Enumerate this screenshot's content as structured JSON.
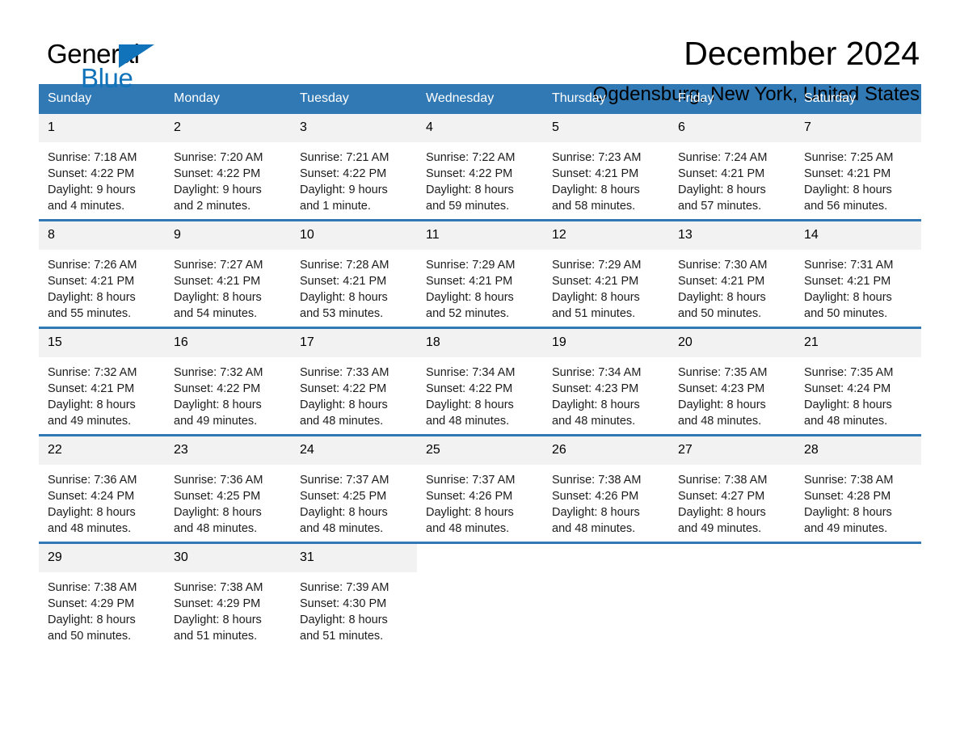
{
  "brand": {
    "name_top": "General",
    "name_bottom": "Blue",
    "triangle_color": "#1173ba",
    "top_color": "#000000",
    "bottom_color": "#1173ba"
  },
  "header": {
    "title": "December 2024",
    "location": "Ogdensburg, New York, United States"
  },
  "theme": {
    "header_bg": "#3179b4",
    "header_text": "#ffffff",
    "daynum_bg": "#f2f2f2",
    "row_divider": "#3179b4",
    "page_bg": "#ffffff"
  },
  "weekdays": [
    "Sunday",
    "Monday",
    "Tuesday",
    "Wednesday",
    "Thursday",
    "Friday",
    "Saturday"
  ],
  "weeks": [
    [
      {
        "day": "1",
        "sunrise": "Sunrise: 7:18 AM",
        "sunset": "Sunset: 4:22 PM",
        "daylight1": "Daylight: 9 hours",
        "daylight2": "and 4 minutes."
      },
      {
        "day": "2",
        "sunrise": "Sunrise: 7:20 AM",
        "sunset": "Sunset: 4:22 PM",
        "daylight1": "Daylight: 9 hours",
        "daylight2": "and 2 minutes."
      },
      {
        "day": "3",
        "sunrise": "Sunrise: 7:21 AM",
        "sunset": "Sunset: 4:22 PM",
        "daylight1": "Daylight: 9 hours",
        "daylight2": "and 1 minute."
      },
      {
        "day": "4",
        "sunrise": "Sunrise: 7:22 AM",
        "sunset": "Sunset: 4:22 PM",
        "daylight1": "Daylight: 8 hours",
        "daylight2": "and 59 minutes."
      },
      {
        "day": "5",
        "sunrise": "Sunrise: 7:23 AM",
        "sunset": "Sunset: 4:21 PM",
        "daylight1": "Daylight: 8 hours",
        "daylight2": "and 58 minutes."
      },
      {
        "day": "6",
        "sunrise": "Sunrise: 7:24 AM",
        "sunset": "Sunset: 4:21 PM",
        "daylight1": "Daylight: 8 hours",
        "daylight2": "and 57 minutes."
      },
      {
        "day": "7",
        "sunrise": "Sunrise: 7:25 AM",
        "sunset": "Sunset: 4:21 PM",
        "daylight1": "Daylight: 8 hours",
        "daylight2": "and 56 minutes."
      }
    ],
    [
      {
        "day": "8",
        "sunrise": "Sunrise: 7:26 AM",
        "sunset": "Sunset: 4:21 PM",
        "daylight1": "Daylight: 8 hours",
        "daylight2": "and 55 minutes."
      },
      {
        "day": "9",
        "sunrise": "Sunrise: 7:27 AM",
        "sunset": "Sunset: 4:21 PM",
        "daylight1": "Daylight: 8 hours",
        "daylight2": "and 54 minutes."
      },
      {
        "day": "10",
        "sunrise": "Sunrise: 7:28 AM",
        "sunset": "Sunset: 4:21 PM",
        "daylight1": "Daylight: 8 hours",
        "daylight2": "and 53 minutes."
      },
      {
        "day": "11",
        "sunrise": "Sunrise: 7:29 AM",
        "sunset": "Sunset: 4:21 PM",
        "daylight1": "Daylight: 8 hours",
        "daylight2": "and 52 minutes."
      },
      {
        "day": "12",
        "sunrise": "Sunrise: 7:29 AM",
        "sunset": "Sunset: 4:21 PM",
        "daylight1": "Daylight: 8 hours",
        "daylight2": "and 51 minutes."
      },
      {
        "day": "13",
        "sunrise": "Sunrise: 7:30 AM",
        "sunset": "Sunset: 4:21 PM",
        "daylight1": "Daylight: 8 hours",
        "daylight2": "and 50 minutes."
      },
      {
        "day": "14",
        "sunrise": "Sunrise: 7:31 AM",
        "sunset": "Sunset: 4:21 PM",
        "daylight1": "Daylight: 8 hours",
        "daylight2": "and 50 minutes."
      }
    ],
    [
      {
        "day": "15",
        "sunrise": "Sunrise: 7:32 AM",
        "sunset": "Sunset: 4:21 PM",
        "daylight1": "Daylight: 8 hours",
        "daylight2": "and 49 minutes."
      },
      {
        "day": "16",
        "sunrise": "Sunrise: 7:32 AM",
        "sunset": "Sunset: 4:22 PM",
        "daylight1": "Daylight: 8 hours",
        "daylight2": "and 49 minutes."
      },
      {
        "day": "17",
        "sunrise": "Sunrise: 7:33 AM",
        "sunset": "Sunset: 4:22 PM",
        "daylight1": "Daylight: 8 hours",
        "daylight2": "and 48 minutes."
      },
      {
        "day": "18",
        "sunrise": "Sunrise: 7:34 AM",
        "sunset": "Sunset: 4:22 PM",
        "daylight1": "Daylight: 8 hours",
        "daylight2": "and 48 minutes."
      },
      {
        "day": "19",
        "sunrise": "Sunrise: 7:34 AM",
        "sunset": "Sunset: 4:23 PM",
        "daylight1": "Daylight: 8 hours",
        "daylight2": "and 48 minutes."
      },
      {
        "day": "20",
        "sunrise": "Sunrise: 7:35 AM",
        "sunset": "Sunset: 4:23 PM",
        "daylight1": "Daylight: 8 hours",
        "daylight2": "and 48 minutes."
      },
      {
        "day": "21",
        "sunrise": "Sunrise: 7:35 AM",
        "sunset": "Sunset: 4:24 PM",
        "daylight1": "Daylight: 8 hours",
        "daylight2": "and 48 minutes."
      }
    ],
    [
      {
        "day": "22",
        "sunrise": "Sunrise: 7:36 AM",
        "sunset": "Sunset: 4:24 PM",
        "daylight1": "Daylight: 8 hours",
        "daylight2": "and 48 minutes."
      },
      {
        "day": "23",
        "sunrise": "Sunrise: 7:36 AM",
        "sunset": "Sunset: 4:25 PM",
        "daylight1": "Daylight: 8 hours",
        "daylight2": "and 48 minutes."
      },
      {
        "day": "24",
        "sunrise": "Sunrise: 7:37 AM",
        "sunset": "Sunset: 4:25 PM",
        "daylight1": "Daylight: 8 hours",
        "daylight2": "and 48 minutes."
      },
      {
        "day": "25",
        "sunrise": "Sunrise: 7:37 AM",
        "sunset": "Sunset: 4:26 PM",
        "daylight1": "Daylight: 8 hours",
        "daylight2": "and 48 minutes."
      },
      {
        "day": "26",
        "sunrise": "Sunrise: 7:38 AM",
        "sunset": "Sunset: 4:26 PM",
        "daylight1": "Daylight: 8 hours",
        "daylight2": "and 48 minutes."
      },
      {
        "day": "27",
        "sunrise": "Sunrise: 7:38 AM",
        "sunset": "Sunset: 4:27 PM",
        "daylight1": "Daylight: 8 hours",
        "daylight2": "and 49 minutes."
      },
      {
        "day": "28",
        "sunrise": "Sunrise: 7:38 AM",
        "sunset": "Sunset: 4:28 PM",
        "daylight1": "Daylight: 8 hours",
        "daylight2": "and 49 minutes."
      }
    ],
    [
      {
        "day": "29",
        "sunrise": "Sunrise: 7:38 AM",
        "sunset": "Sunset: 4:29 PM",
        "daylight1": "Daylight: 8 hours",
        "daylight2": "and 50 minutes."
      },
      {
        "day": "30",
        "sunrise": "Sunrise: 7:38 AM",
        "sunset": "Sunset: 4:29 PM",
        "daylight1": "Daylight: 8 hours",
        "daylight2": "and 51 minutes."
      },
      {
        "day": "31",
        "sunrise": "Sunrise: 7:39 AM",
        "sunset": "Sunset: 4:30 PM",
        "daylight1": "Daylight: 8 hours",
        "daylight2": "and 51 minutes."
      },
      {
        "day": "",
        "sunrise": "",
        "sunset": "",
        "daylight1": "",
        "daylight2": ""
      },
      {
        "day": "",
        "sunrise": "",
        "sunset": "",
        "daylight1": "",
        "daylight2": ""
      },
      {
        "day": "",
        "sunrise": "",
        "sunset": "",
        "daylight1": "",
        "daylight2": ""
      },
      {
        "day": "",
        "sunrise": "",
        "sunset": "",
        "daylight1": "",
        "daylight2": ""
      }
    ]
  ]
}
